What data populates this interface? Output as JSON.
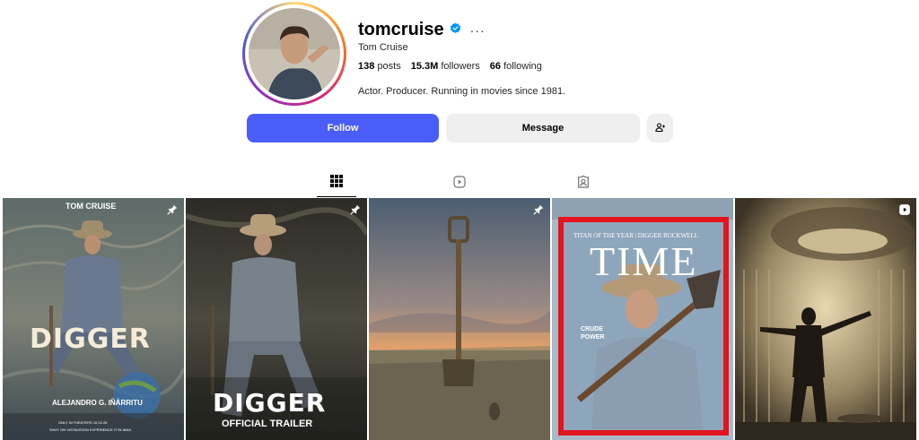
{
  "profile": {
    "username": "tomcruise",
    "verified": true,
    "more_icon": "···",
    "full_name": "Tom Cruise",
    "stats": {
      "posts_count": "138",
      "posts_label": "posts",
      "followers_count": "15.3M",
      "followers_label": "followers",
      "following_count": "66",
      "following_label": "following"
    },
    "bio": "Actor. Producer. Running in movies since 1981."
  },
  "actions": {
    "follow_label": "Follow",
    "message_label": "Message",
    "add_user_icon": "add-user-icon"
  },
  "tabs": [
    {
      "icon": "grid-icon",
      "active": true
    },
    {
      "icon": "reels-icon",
      "active": false
    },
    {
      "icon": "tagged-icon",
      "active": false
    }
  ],
  "colors": {
    "follow_blue": "#4a5df9",
    "verified_blue": "#0095f6",
    "time_red": "#e2141e"
  },
  "posts": [
    {
      "badge": "pin-icon",
      "texts": {
        "star": "TOM CRUISE",
        "title": "DIGGER",
        "director": "ALEJANDRO G. IÑÁRRITU",
        "release": "ONLY IN THEATERS 10.02.26",
        "formats": "SHOT ON VISTAVISION   EXPERIENCE IT IN IMAX"
      }
    },
    {
      "badge": "pin-icon",
      "texts": {
        "title": "DIGGER",
        "subtitle": "OFFICIAL TRAILER"
      }
    },
    {
      "badge": "pin-icon",
      "texts": {}
    },
    {
      "badge": "",
      "texts": {
        "masthead": "TIME",
        "tagline": "TITAN OF THE YEAR | DIGGER ROCKWELL",
        "cover_line_1": "CRUDE",
        "cover_line_2": "POWER"
      }
    },
    {
      "badge": "reel-icon",
      "texts": {}
    }
  ]
}
